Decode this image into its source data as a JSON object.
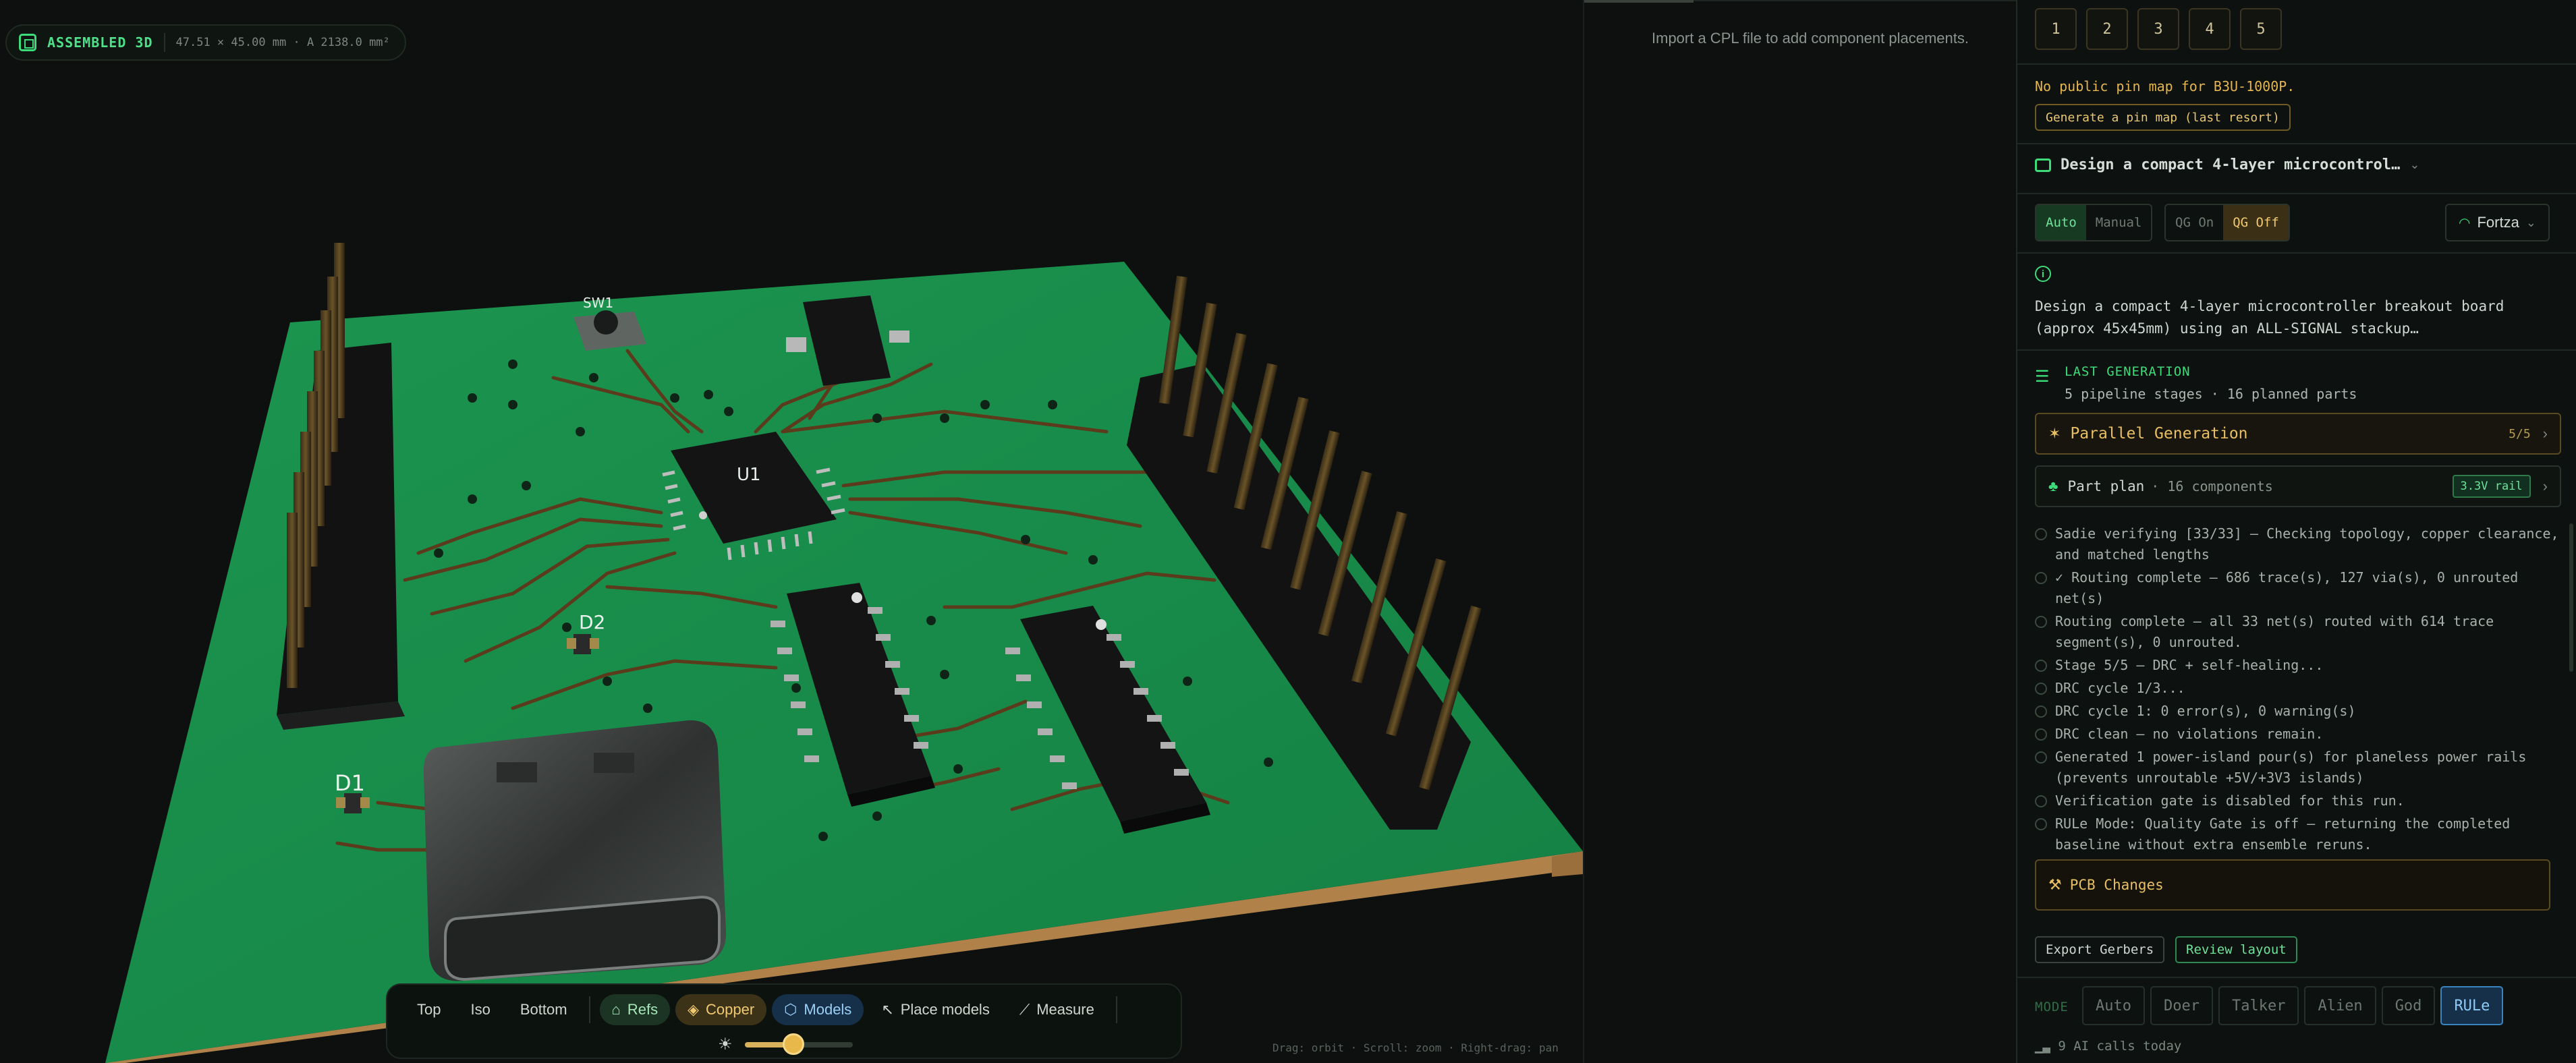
{
  "viewport": {
    "badge_title": "ASSEMBLED 3D",
    "badge_dims": "47.51 × 45.00 mm · A 2138.0 mm²",
    "silkscreen": {
      "sw1": "SW1",
      "u1": "U1",
      "d1": "D1",
      "d2": "D2"
    },
    "toolbar": {
      "top": "Top",
      "iso": "Iso",
      "bottom": "Bottom",
      "refs": "Refs",
      "copper": "Copper",
      "models": "Models",
      "place_models": "Place models",
      "measure": "Measure"
    },
    "brightness": 0.45,
    "hint": "Drag: orbit · Scroll: zoom · Right-drag: pan"
  },
  "cpl_panel": {
    "message": "Import a CPL file to add component placements."
  },
  "sidebar": {
    "steps": [
      "1",
      "2",
      "3",
      "4",
      "5"
    ],
    "warning": "No public pin map for B3U-1000P.",
    "pinmap_button": "Generate a pin map (last resort)",
    "project_name": "Design a compact 4-layer microcontrol…",
    "seg_mode": {
      "auto": "Auto",
      "manual": "Manual"
    },
    "seg_qg": {
      "on": "QG On",
      "off": "QG Off"
    },
    "model": "Fortza",
    "description": "Design a compact 4-layer microcontroller breakout board (approx 45x45mm) using an ALL-SIGNAL stackup…",
    "last_generation": {
      "label": "LAST GENERATION",
      "summary": "5 pipeline stages · 16 planned parts"
    },
    "parallel": {
      "label": "Parallel Generation",
      "count": "5/5"
    },
    "part_plan": {
      "label": "Part plan",
      "sub": "· 16 components",
      "rail": "3.3V rail"
    },
    "log": [
      "Sadie verifying [33/33] — Checking topology, copper clearance, and matched lengths",
      "✓ Routing complete — 686 trace(s), 127 via(s), 0 unrouted net(s)",
      "Routing complete — all 33 net(s) routed with 614 trace segment(s), 0 unrouted.",
      "Stage 5/5 — DRC + self-healing...",
      "DRC cycle 1/3...",
      "DRC cycle 1: 0 error(s), 0 warning(s)",
      "DRC clean — no violations remain.",
      "Generated 1 power-island pour(s) for planeless power rails (prevents unroutable +5V/+3V3 islands)",
      "Verification gate is disabled for this run.",
      "RULe Mode: Quality Gate is off — returning the completed baseline without extra ensemble reruns."
    ],
    "pcb_changes": "PCB Changes",
    "export_gerbers": "Export Gerbers",
    "review_layout": "Review layout",
    "mode_label": "MODE",
    "modes": [
      "Auto",
      "Doer",
      "Talker",
      "Alien",
      "God",
      "RULe"
    ],
    "ai_calls": "9 AI calls today"
  },
  "colors": {
    "accent": "#3ddc7a",
    "amber": "#e8bf62",
    "board": "#1a8a4a",
    "active_mode": "#8fcaf6"
  }
}
